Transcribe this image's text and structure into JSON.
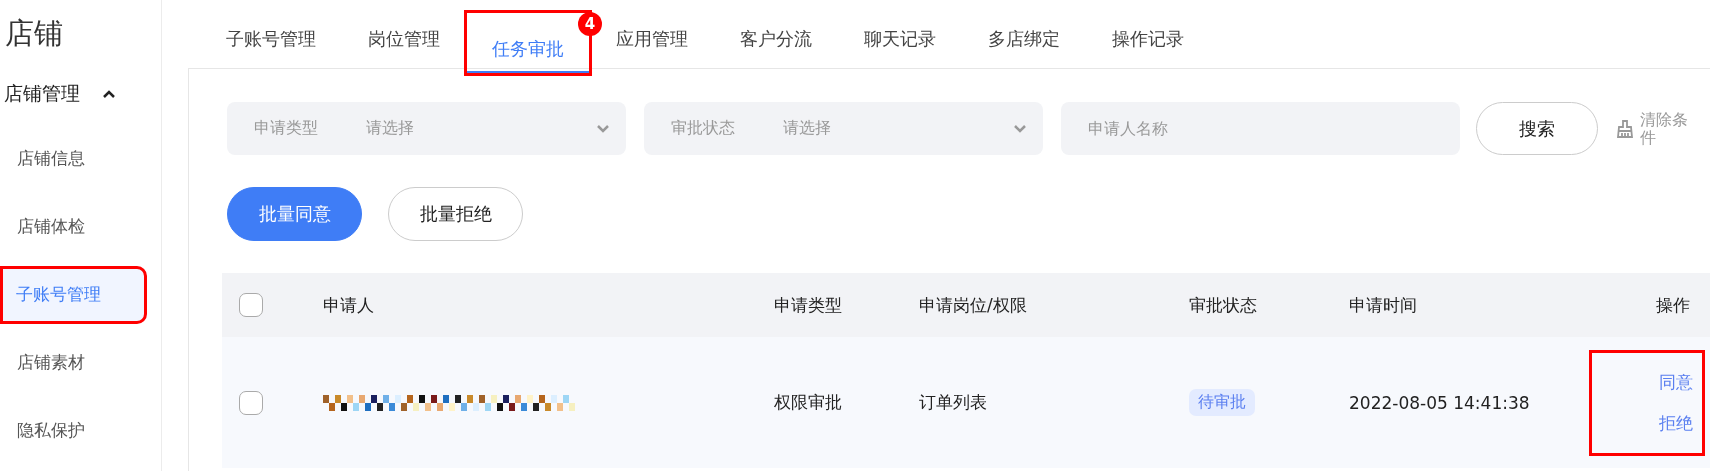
{
  "sidebar": {
    "title": "店铺",
    "group": {
      "label": "店铺管理",
      "expanded": true,
      "items": [
        {
          "label": "店铺信息",
          "selected": false,
          "annotated": false
        },
        {
          "label": "店铺体检",
          "selected": false,
          "annotated": false
        },
        {
          "label": "子账号管理",
          "selected": true,
          "annotated": true
        },
        {
          "label": "店铺素材",
          "selected": false,
          "annotated": false
        },
        {
          "label": "隐私保护",
          "selected": false,
          "annotated": false
        }
      ]
    }
  },
  "tabs": [
    {
      "label": "子账号管理",
      "selected": false,
      "annotated": false
    },
    {
      "label": "岗位管理",
      "selected": false,
      "annotated": false
    },
    {
      "label": "任务审批",
      "selected": true,
      "annotated": true,
      "badge": "4"
    },
    {
      "label": "应用管理",
      "selected": false,
      "annotated": false
    },
    {
      "label": "客户分流",
      "selected": false,
      "annotated": false
    },
    {
      "label": "聊天记录",
      "selected": false,
      "annotated": false
    },
    {
      "label": "多店绑定",
      "selected": false,
      "annotated": false
    },
    {
      "label": "操作记录",
      "selected": false,
      "annotated": false
    }
  ],
  "filters": [
    {
      "kind": "select",
      "label": "申请类型",
      "placeholder": "请选择"
    },
    {
      "kind": "select",
      "label": "审批状态",
      "placeholder": "请选择"
    },
    {
      "kind": "input",
      "placeholder": "申请人名称"
    }
  ],
  "search_button": "搜索",
  "clear_button": "清除条件",
  "batch_buttons": [
    {
      "label": "批量同意",
      "kind": "primary"
    },
    {
      "label": "批量拒绝",
      "kind": "default"
    }
  ],
  "table": {
    "select_all_checked": false,
    "columns": [
      "申请人",
      "申请类型",
      "申请岗位/权限",
      "审批状态",
      "申请时间",
      "操作"
    ],
    "rows": [
      {
        "checked": false,
        "applicant": {
          "redacted": true
        },
        "type": "权限审批",
        "position": "订单列表",
        "status": {
          "label": "待审批",
          "kind": "pending"
        },
        "time": "2022-08-05 14:41:38",
        "actions": [
          "同意",
          "拒绝"
        ],
        "actions_annotated": true
      }
    ]
  }
}
